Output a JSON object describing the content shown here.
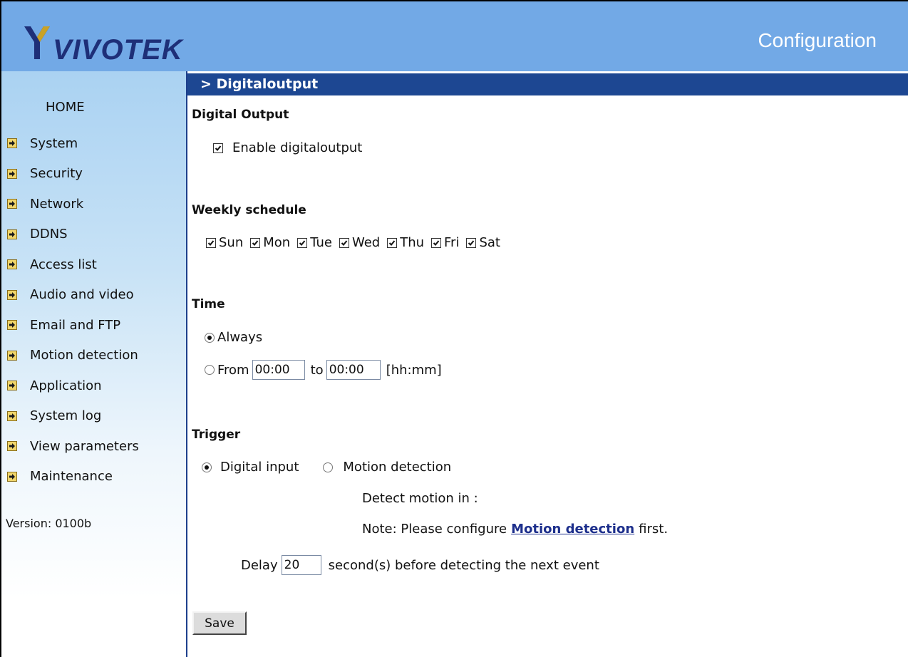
{
  "header": {
    "logo_text": "VIVOTEK",
    "config_label": "Configuration"
  },
  "sidebar": {
    "home": "HOME",
    "items": [
      {
        "label": "System"
      },
      {
        "label": "Security"
      },
      {
        "label": "Network"
      },
      {
        "label": "DDNS"
      },
      {
        "label": "Access list"
      },
      {
        "label": "Audio and video"
      },
      {
        "label": "Email and FTP"
      },
      {
        "label": "Motion detection"
      },
      {
        "label": "Application"
      },
      {
        "label": "System log"
      },
      {
        "label": "View parameters"
      },
      {
        "label": "Maintenance"
      }
    ],
    "version": "Version: 0100b"
  },
  "page": {
    "title": "> Digitaloutput",
    "digital_output": {
      "heading": "Digital Output",
      "enable_label": "Enable digitaloutput",
      "enabled": true
    },
    "weekly": {
      "heading": "Weekly schedule",
      "days": [
        {
          "label": "Sun",
          "checked": true
        },
        {
          "label": "Mon",
          "checked": true
        },
        {
          "label": "Tue",
          "checked": true
        },
        {
          "label": "Wed",
          "checked": true
        },
        {
          "label": "Thu",
          "checked": true
        },
        {
          "label": "Fri",
          "checked": true
        },
        {
          "label": "Sat",
          "checked": true
        }
      ]
    },
    "time": {
      "heading": "Time",
      "always_label": "Always",
      "from_label": "From",
      "from_value": "00:00",
      "to_label": "to",
      "to_value": "00:00",
      "format_hint": "[hh:mm]",
      "selected": "always"
    },
    "trigger": {
      "heading": "Trigger",
      "digital_input_label": "Digital input",
      "motion_label": "Motion detection",
      "selected": "digital_input",
      "detect_label": "Detect motion in :",
      "note_prefix": "Note: Please configure",
      "note_link": "Motion detection",
      "note_suffix": "first.",
      "delay_label": "Delay",
      "delay_value": "20",
      "delay_suffix": "second(s) before detecting the next event"
    },
    "save_label": "Save"
  },
  "colors": {
    "header_bg": "#72a9e6",
    "titlebar_bg": "#1d4792",
    "link": "#1d2f8c"
  }
}
